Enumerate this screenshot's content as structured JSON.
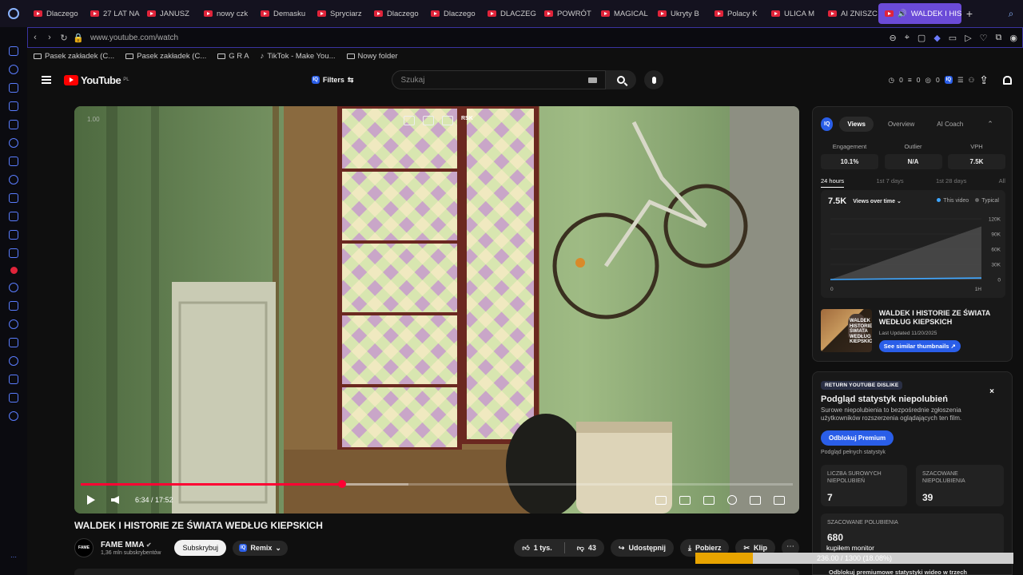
{
  "browser": {
    "tabs": [
      {
        "label": "Dlaczego"
      },
      {
        "label": "27 LAT NA"
      },
      {
        "label": "JANUSZ"
      },
      {
        "label": "nowy czk"
      },
      {
        "label": "Demasku"
      },
      {
        "label": "Spryciarz"
      },
      {
        "label": "Dlaczego"
      },
      {
        "label": "Dlaczego"
      },
      {
        "label": "DLACZEG"
      },
      {
        "label": "POWRÓT"
      },
      {
        "label": "MAGICAL"
      },
      {
        "label": "Ukryty B"
      },
      {
        "label": "Polacy K"
      },
      {
        "label": "ULICA M"
      },
      {
        "label": "AI ZNISZC"
      }
    ],
    "active_tab": "WALDEK I HIST",
    "url": "www.youtube.com/watch",
    "bookmarks": [
      {
        "label": "Pasek zakładek (C..."
      },
      {
        "label": "Pasek zakładek (C..."
      },
      {
        "label": "G R A"
      },
      {
        "label": "TikTok - Make You..."
      },
      {
        "label": "Nowy folder"
      }
    ]
  },
  "youtube": {
    "logo_text": "YouTube",
    "country": "PL",
    "filters_label": "Filters",
    "search_placeholder": "Szukaj",
    "header_stats": [
      "0",
      "0",
      "0"
    ]
  },
  "video": {
    "overlay_number": "1.00",
    "rsk_label": "RSK",
    "time": "6:34 / 17:52",
    "progress_fraction": 0.367,
    "title": "WALDEK I HISTORIE ZE ŚWIATA WEDŁUG KIEPSKICH",
    "channel": "FAME MMA",
    "channel_avatar_text": "FAME",
    "subscribers": "1,36 mln subskrybentów",
    "subscribe_label": "Subskrybuj",
    "remix_label": "Remix",
    "likes": "1 tys.",
    "dislikes": "43",
    "share_label": "Udostępnij",
    "download_label": "Pobierz",
    "clip_label": "Klip",
    "more_label": "⋯"
  },
  "analytics": {
    "tabs": [
      "Views",
      "Overview",
      "AI Coach"
    ],
    "stats": [
      {
        "label": "Engagement",
        "value": "10.1%"
      },
      {
        "label": "Outlier",
        "value": "N/A"
      },
      {
        "label": "VPH",
        "value": "7.5K"
      }
    ],
    "ranges": [
      "24 hours",
      "1st 7 days",
      "1st 28 days",
      "All"
    ],
    "big_value": "7.5K",
    "selector": "Views over time",
    "legend": [
      "This video",
      "Typical"
    ],
    "thumb_title": "WALDEK I HISTORIE ZE ŚWIATA WEDŁUG KIEPSKICH",
    "thumb_overlay_text": "WALDEK I HISTORIE ZE ŚWIATA WEDŁUG KIEPSKICH",
    "last_updated": "Last Updated 11/20/2025",
    "similar_label": "See similar thumbnails ↗"
  },
  "chart_data": {
    "type": "area",
    "x": [
      0,
      1
    ],
    "xtick_labels": [
      "0",
      "1H"
    ],
    "ylim": [
      0,
      120000
    ],
    "yticks": [
      0,
      30000,
      60000,
      90000,
      120000
    ],
    "ytick_labels": [
      "0",
      "30K",
      "60K",
      "90K",
      "120K"
    ],
    "series": [
      {
        "name": "This video",
        "values": [
          0,
          3000
        ],
        "color": "#3ea6ff"
      },
      {
        "name": "Typical",
        "values": [
          0,
          105000
        ],
        "color": "#555555"
      }
    ]
  },
  "dislikes": {
    "badge": "RETURN YOUTUBE DISLIKE",
    "close": "×",
    "title": "Podgląd statystyk niepolubień",
    "description": "Surowe niepolubienia to bezpośrednie zgłoszenia użytkowników rozszerzenia oglądających ten film.",
    "unlock_label": "Odblokuj Premium",
    "sub_text": "Podgląd pełnych statystyk",
    "raw_label": "LICZBA SUROWYCH NIEPOLUBIEŃ",
    "raw_value": "7",
    "est_label": "SZACOWANE NIEPOLUBIENIA",
    "est_value": "39",
    "likes_label": "SZACOWANE POLUBIENIA",
    "likes_value": "680",
    "caption": "kupiłem monitor",
    "footer": "Odblokuj premiumowe statystyki wideo w trzech"
  },
  "download": {
    "text": "236.00 / 1300 (18.08%)",
    "fraction": 0.1808
  },
  "colors": {
    "accent": "#2a5ee8",
    "progress": "#ff0033",
    "download": "#e8a400",
    "active_tab": "#6b4bd8"
  }
}
